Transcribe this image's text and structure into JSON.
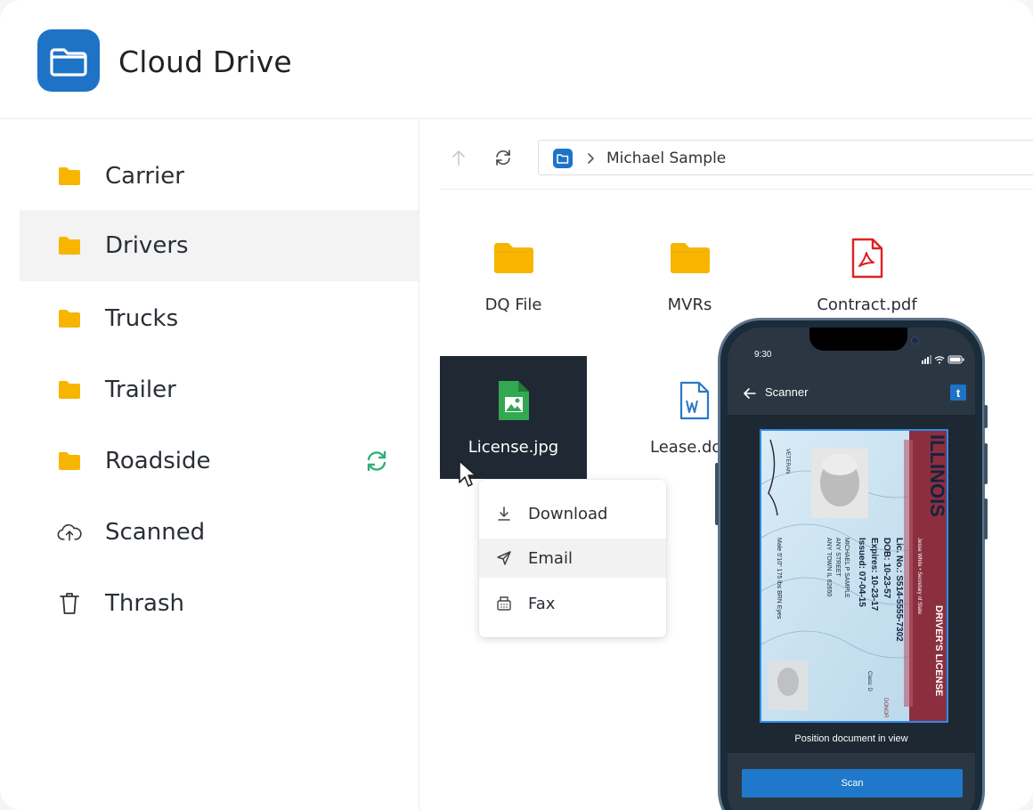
{
  "app": {
    "title": "Cloud Drive",
    "accent": "#1e73c7"
  },
  "sidebar": {
    "items": [
      {
        "label": "Carrier",
        "icon": "folder-icon"
      },
      {
        "label": "Drivers",
        "icon": "folder-icon",
        "selected": true
      },
      {
        "label": "Trucks",
        "icon": "folder-icon"
      },
      {
        "label": "Trailer",
        "icon": "folder-icon"
      },
      {
        "label": "Roadside",
        "icon": "folder-icon",
        "status": "sync-icon"
      },
      {
        "label": "Scanned",
        "icon": "cloud-upload-icon"
      },
      {
        "label": "Thrash",
        "icon": "trash-icon"
      }
    ]
  },
  "toolbar": {
    "up_icon": "arrow-up-icon",
    "refresh_icon": "refresh-icon",
    "path": "Michael Sample"
  },
  "files": [
    {
      "name": "DQ File",
      "type": "folder"
    },
    {
      "name": "MVRs",
      "type": "folder"
    },
    {
      "name": "Contract.pdf",
      "type": "pdf"
    },
    {
      "name": "License.jpg",
      "type": "image",
      "selected": true
    },
    {
      "name": "Lease.doc",
      "type": "word"
    }
  ],
  "context_menu": {
    "items": [
      {
        "label": "Download",
        "icon": "download-icon"
      },
      {
        "label": "Email",
        "icon": "send-icon",
        "hover": true
      },
      {
        "label": "Fax",
        "icon": "fax-icon"
      }
    ]
  },
  "phone": {
    "time": "9:30",
    "title": "Scanner",
    "brand_letter": "t",
    "hint": "Position document in view",
    "scan_label": "Scan",
    "license": {
      "state": "ILLINOIS",
      "type": "DRIVER'S LICENSE",
      "secretary": "Jesse White • Secretary of State",
      "lic_no": "Lic. No.: S514-5555-7302",
      "dob": "DOB: 10-23-57",
      "expires": "Expires: 10-23-17",
      "issued": "Issued: 07-04-15",
      "name1": "MICHAEL P SAMPLE",
      "name2": "ANY STREET",
      "name3": "ANY TOWN IL 62650",
      "details": "Male   5'10\"  175 lbs  BRN Eyes",
      "veteran": "VETERAN",
      "class": "Class: D",
      "donor": "DONOR"
    }
  }
}
